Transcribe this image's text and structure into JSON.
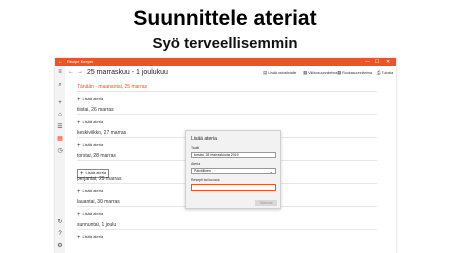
{
  "hero": {
    "title": "Suunnittele ateriat",
    "subtitle": "Syö terveellisemmin"
  },
  "window": {
    "app_name": "Recipe Keeper",
    "window_controls": [
      "—",
      "☐",
      "✕"
    ]
  },
  "leftnav": {
    "icons": [
      "menu-icon",
      "search-icon",
      "add-icon",
      "home-icon",
      "list-icon",
      "calendar-icon",
      "clock-icon",
      "sync-icon",
      "help-icon",
      "settings-icon"
    ],
    "active": "calendar-icon"
  },
  "toolbar": {
    "date_range": "25 marraskuu - 1 joulukuu",
    "actions": [
      {
        "label": "Lisää ostoslistalle",
        "icon": "cart-icon"
      },
      {
        "label": "Viikkosuunnitelma",
        "icon": "calendar-icon"
      },
      {
        "label": "Ruokasuunnitelma",
        "icon": "calendar-icon"
      },
      {
        "label": "Tulosta",
        "icon": "print-icon"
      }
    ]
  },
  "days": [
    {
      "title": "Tänään - maanantai, 25 marras",
      "today": true,
      "add_label": "Lisää ateria"
    },
    {
      "title": "tiistai, 26 marras",
      "today": false,
      "add_label": "Lisää ateria"
    },
    {
      "title": "keskiviikko, 27 marras",
      "today": false,
      "add_label": "Lisää ateria"
    },
    {
      "title": "torstai, 28 marras",
      "today": false,
      "add_label": "Lisää ateria"
    },
    {
      "title": "perjantai, 29 marras",
      "today": false,
      "add_label": "Lisää ateria"
    },
    {
      "title": "lauantai, 30 marras",
      "today": false,
      "add_label": "Lisää ateria"
    },
    {
      "title": "sunnuntai, 1 joulu",
      "today": false,
      "add_label": "Lisää ateria"
    }
  ],
  "dialog": {
    "title": "Lisää ateria",
    "date_label": "Taulti",
    "date_value": "torstai, 28 marraskuuta 2019",
    "meal_label": "Ateria",
    "meal_value": "Päivällinen",
    "recipe_label": "Resepti tai kuvaus",
    "recipe_value": "",
    "submit_label": "Tallenna"
  },
  "colors": {
    "accent": "#e8552a"
  }
}
